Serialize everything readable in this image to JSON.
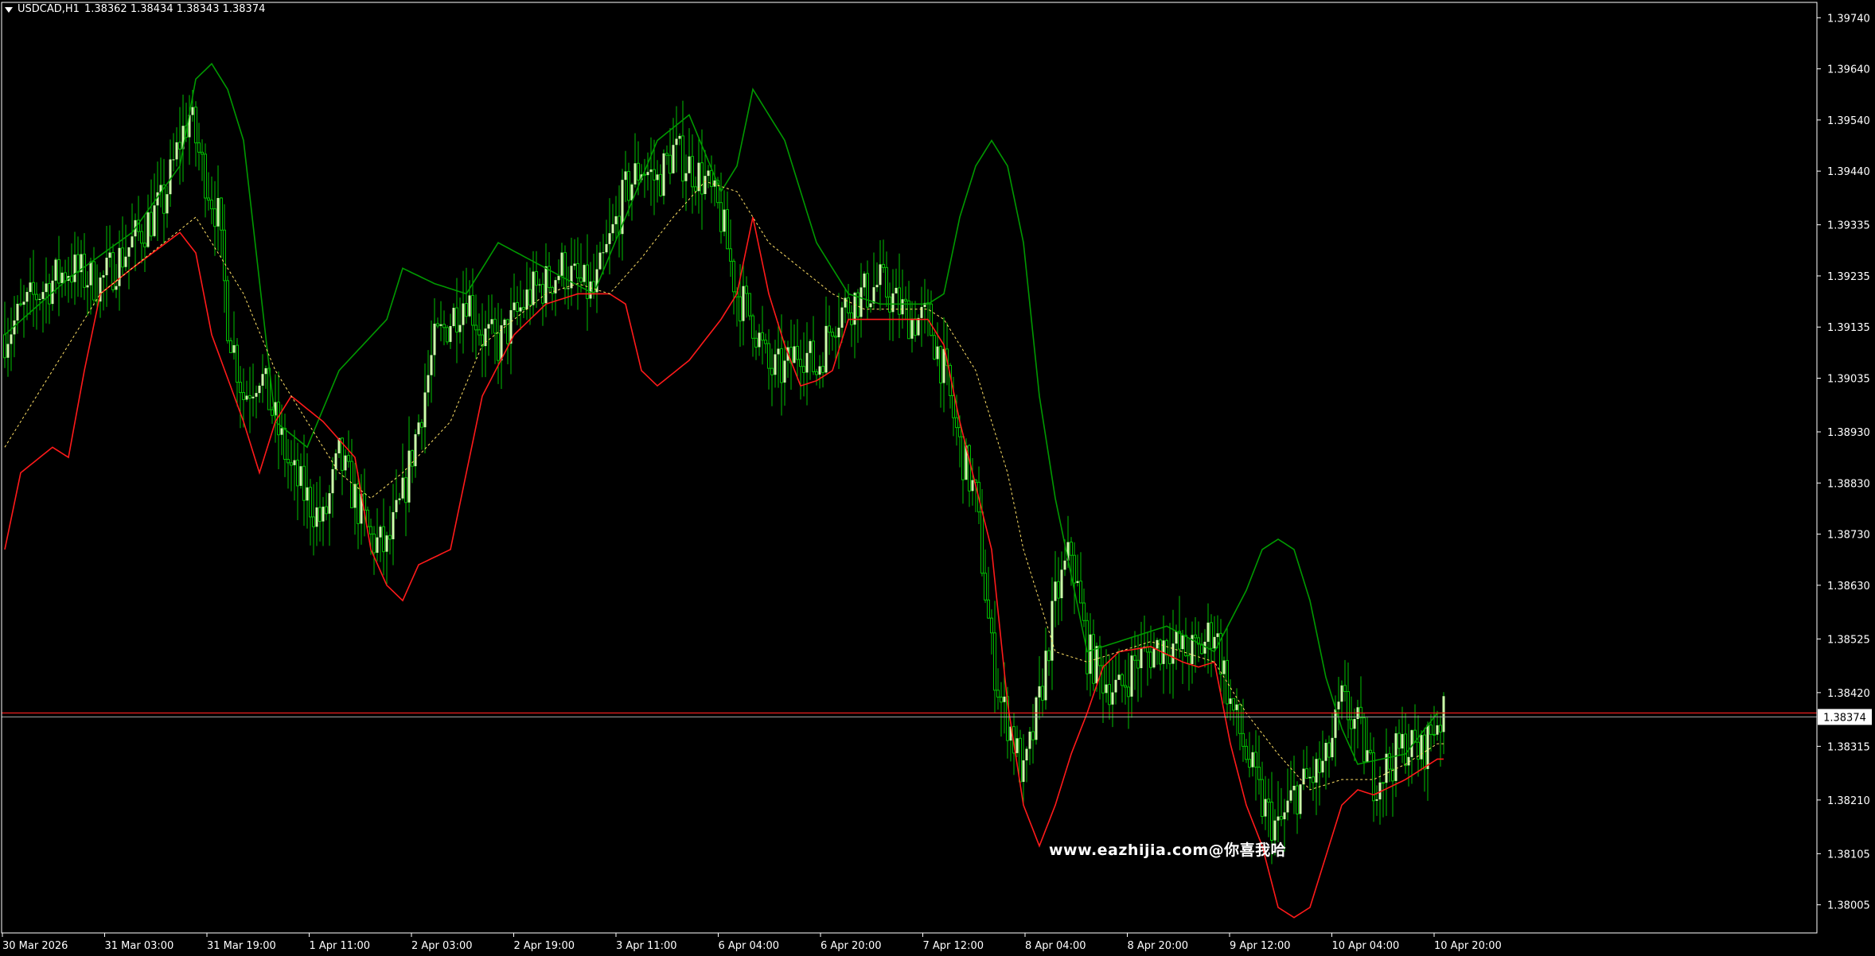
{
  "header": {
    "symbol_timeframe": "USDCAD,H1",
    "ohlc": "1.38362 1.38434 1.38343 1.38374"
  },
  "watermark": "www.eazhijia.com@你喜我哈",
  "colors": {
    "background": "#000000",
    "bull_candle": "#ccffaa",
    "wick": "#00c000",
    "upper_band": "#009900",
    "lower_band": "#ff1a1a",
    "middle_band": "#ffe066",
    "price_line": "#ff2020",
    "grid_axis": "#ffffff"
  },
  "chart_data": {
    "type": "candlestick",
    "symbol": "USDCAD",
    "timeframe": "H1",
    "ylim": [
      1.3795,
      1.3977
    ],
    "price_ticks": [
      "1.39740",
      "1.39640",
      "1.39540",
      "1.39440",
      "1.39335",
      "1.39235",
      "1.39135",
      "1.39035",
      "1.38930",
      "1.38830",
      "1.38730",
      "1.38630",
      "1.38525",
      "1.38420",
      "1.38315",
      "1.38210",
      "1.38105",
      "1.38005"
    ],
    "time_ticks": [
      "30 Mar 2026",
      "31 Mar 03:00",
      "31 Mar 19:00",
      "1 Apr 11:00",
      "2 Apr 03:00",
      "2 Apr 19:00",
      "3 Apr 11:00",
      "6 Apr 04:00",
      "6 Apr 20:00",
      "7 Apr 12:00",
      "8 Apr 04:00",
      "8 Apr 20:00",
      "9 Apr 12:00",
      "10 Apr 04:00",
      "10 Apr 20:00"
    ],
    "current_price": "1.38374",
    "close_path": [
      [
        0,
        1.3912
      ],
      [
        10,
        1.392
      ],
      [
        20,
        1.3925
      ],
      [
        30,
        1.3922
      ],
      [
        40,
        1.393
      ],
      [
        50,
        1.3938
      ],
      [
        55,
        1.395
      ],
      [
        58,
        1.3955
      ],
      [
        62,
        1.3945
      ],
      [
        67,
        1.3935
      ],
      [
        70,
        1.3915
      ],
      [
        75,
        1.39
      ],
      [
        80,
        1.3905
      ],
      [
        85,
        1.3895
      ],
      [
        90,
        1.3885
      ],
      [
        95,
        1.388
      ],
      [
        100,
        1.3875
      ],
      [
        105,
        1.3888
      ],
      [
        110,
        1.388
      ],
      [
        115,
        1.3872
      ],
      [
        120,
        1.387
      ],
      [
        125,
        1.388
      ],
      [
        130,
        1.3895
      ],
      [
        135,
        1.391
      ],
      [
        140,
        1.3915
      ],
      [
        145,
        1.392
      ],
      [
        150,
        1.3912
      ],
      [
        155,
        1.391
      ],
      [
        160,
        1.3915
      ],
      [
        165,
        1.392
      ],
      [
        170,
        1.3922
      ],
      [
        175,
        1.3925
      ],
      [
        180,
        1.3922
      ],
      [
        185,
        1.392
      ],
      [
        190,
        1.393
      ],
      [
        195,
        1.394
      ],
      [
        200,
        1.3945
      ],
      [
        205,
        1.3942
      ],
      [
        210,
        1.3948
      ],
      [
        215,
        1.3945
      ],
      [
        220,
        1.3942
      ],
      [
        225,
        1.3935
      ],
      [
        230,
        1.392
      ],
      [
        235,
        1.3915
      ],
      [
        240,
        1.3905
      ],
      [
        245,
        1.3905
      ],
      [
        250,
        1.391
      ],
      [
        255,
        1.3905
      ],
      [
        260,
        1.3915
      ],
      [
        265,
        1.3918
      ],
      [
        270,
        1.392
      ],
      [
        275,
        1.3922
      ],
      [
        280,
        1.3918
      ],
      [
        285,
        1.3915
      ],
      [
        290,
        1.3915
      ],
      [
        295,
        1.3905
      ],
      [
        300,
        1.389
      ],
      [
        305,
        1.388
      ],
      [
        310,
        1.385
      ],
      [
        313,
        1.384
      ],
      [
        316,
        1.3835
      ],
      [
        320,
        1.3825
      ],
      [
        325,
        1.384
      ],
      [
        330,
        1.386
      ],
      [
        335,
        1.387
      ],
      [
        340,
        1.385
      ],
      [
        345,
        1.3845
      ],
      [
        350,
        1.3842
      ],
      [
        355,
        1.3848
      ],
      [
        360,
        1.385
      ],
      [
        365,
        1.3852
      ],
      [
        370,
        1.385
      ],
      [
        375,
        1.385
      ],
      [
        380,
        1.3855
      ],
      [
        385,
        1.384
      ],
      [
        390,
        1.383
      ],
      [
        395,
        1.382
      ],
      [
        400,
        1.3815
      ],
      [
        405,
        1.3822
      ],
      [
        410,
        1.3825
      ],
      [
        415,
        1.3828
      ],
      [
        420,
        1.384
      ],
      [
        425,
        1.3835
      ],
      [
        430,
        1.3825
      ],
      [
        435,
        1.3828
      ],
      [
        440,
        1.3832
      ],
      [
        445,
        1.383
      ],
      [
        450,
        1.3837
      ]
    ],
    "upper_band_path": [
      [
        0,
        1.3912
      ],
      [
        20,
        1.3923
      ],
      [
        40,
        1.3932
      ],
      [
        55,
        1.3945
      ],
      [
        60,
        1.3962
      ],
      [
        65,
        1.3965
      ],
      [
        70,
        1.396
      ],
      [
        75,
        1.395
      ],
      [
        85,
        1.3895
      ],
      [
        95,
        1.389
      ],
      [
        105,
        1.3905
      ],
      [
        120,
        1.3915
      ],
      [
        125,
        1.3925
      ],
      [
        135,
        1.3922
      ],
      [
        145,
        1.392
      ],
      [
        155,
        1.393
      ],
      [
        170,
        1.3925
      ],
      [
        185,
        1.392
      ],
      [
        195,
        1.3935
      ],
      [
        205,
        1.395
      ],
      [
        215,
        1.3955
      ],
      [
        225,
        1.394
      ],
      [
        230,
        1.3945
      ],
      [
        235,
        1.396
      ],
      [
        240,
        1.3955
      ],
      [
        245,
        1.395
      ],
      [
        255,
        1.393
      ],
      [
        265,
        1.392
      ],
      [
        275,
        1.3918
      ],
      [
        290,
        1.3918
      ],
      [
        295,
        1.392
      ],
      [
        300,
        1.3935
      ],
      [
        305,
        1.3945
      ],
      [
        310,
        1.395
      ],
      [
        315,
        1.3945
      ],
      [
        320,
        1.393
      ],
      [
        325,
        1.39
      ],
      [
        330,
        1.388
      ],
      [
        335,
        1.3865
      ],
      [
        340,
        1.385
      ],
      [
        350,
        1.3852
      ],
      [
        365,
        1.3855
      ],
      [
        380,
        1.385
      ],
      [
        390,
        1.3862
      ],
      [
        395,
        1.387
      ],
      [
        400,
        1.3872
      ],
      [
        405,
        1.387
      ],
      [
        410,
        1.386
      ],
      [
        415,
        1.3845
      ],
      [
        420,
        1.3835
      ],
      [
        425,
        1.3828
      ],
      [
        440,
        1.383
      ],
      [
        450,
        1.3838
      ]
    ],
    "lower_band_path": [
      [
        0,
        1.387
      ],
      [
        5,
        1.3885
      ],
      [
        15,
        1.389
      ],
      [
        20,
        1.3888
      ],
      [
        25,
        1.3905
      ],
      [
        30,
        1.392
      ],
      [
        40,
        1.3925
      ],
      [
        55,
        1.3932
      ],
      [
        60,
        1.3928
      ],
      [
        65,
        1.3912
      ],
      [
        75,
        1.3895
      ],
      [
        80,
        1.3885
      ],
      [
        85,
        1.3895
      ],
      [
        90,
        1.39
      ],
      [
        100,
        1.3895
      ],
      [
        110,
        1.3888
      ],
      [
        115,
        1.387
      ],
      [
        120,
        1.3863
      ],
      [
        125,
        1.386
      ],
      [
        130,
        1.3867
      ],
      [
        140,
        1.387
      ],
      [
        145,
        1.3885
      ],
      [
        150,
        1.39
      ],
      [
        160,
        1.3912
      ],
      [
        170,
        1.3918
      ],
      [
        180,
        1.392
      ],
      [
        190,
        1.392
      ],
      [
        195,
        1.3918
      ],
      [
        200,
        1.3905
      ],
      [
        205,
        1.3902
      ],
      [
        215,
        1.3907
      ],
      [
        225,
        1.3915
      ],
      [
        230,
        1.392
      ],
      [
        235,
        1.3935
      ],
      [
        240,
        1.392
      ],
      [
        245,
        1.391
      ],
      [
        250,
        1.3902
      ],
      [
        255,
        1.3903
      ],
      [
        260,
        1.3905
      ],
      [
        265,
        1.3915
      ],
      [
        275,
        1.3915
      ],
      [
        290,
        1.3915
      ],
      [
        295,
        1.391
      ],
      [
        300,
        1.3895
      ],
      [
        310,
        1.387
      ],
      [
        315,
        1.384
      ],
      [
        320,
        1.382
      ],
      [
        325,
        1.3812
      ],
      [
        330,
        1.382
      ],
      [
        335,
        1.383
      ],
      [
        340,
        1.3838
      ],
      [
        345,
        1.3847
      ],
      [
        350,
        1.385
      ],
      [
        360,
        1.3851
      ],
      [
        370,
        1.3848
      ],
      [
        375,
        1.3847
      ],
      [
        380,
        1.3848
      ],
      [
        385,
        1.3832
      ],
      [
        390,
        1.382
      ],
      [
        395,
        1.3812
      ],
      [
        400,
        1.38
      ],
      [
        405,
        1.3798
      ],
      [
        410,
        1.38
      ],
      [
        415,
        1.381
      ],
      [
        420,
        1.382
      ],
      [
        425,
        1.3823
      ],
      [
        430,
        1.3822
      ],
      [
        440,
        1.3825
      ],
      [
        450,
        1.3829
      ]
    ],
    "middle_band_path": [
      [
        0,
        1.389
      ],
      [
        15,
        1.3905
      ],
      [
        30,
        1.392
      ],
      [
        50,
        1.393
      ],
      [
        60,
        1.3935
      ],
      [
        65,
        1.393
      ],
      [
        75,
        1.392
      ],
      [
        85,
        1.3905
      ],
      [
        95,
        1.3895
      ],
      [
        105,
        1.3885
      ],
      [
        115,
        1.388
      ],
      [
        125,
        1.3885
      ],
      [
        140,
        1.3895
      ],
      [
        150,
        1.391
      ],
      [
        160,
        1.3915
      ],
      [
        170,
        1.392
      ],
      [
        180,
        1.3922
      ],
      [
        190,
        1.392
      ],
      [
        200,
        1.3927
      ],
      [
        210,
        1.3935
      ],
      [
        220,
        1.3942
      ],
      [
        230,
        1.394
      ],
      [
        240,
        1.393
      ],
      [
        250,
        1.3925
      ],
      [
        260,
        1.392
      ],
      [
        270,
        1.3917
      ],
      [
        280,
        1.3917
      ],
      [
        290,
        1.3917
      ],
      [
        295,
        1.3915
      ],
      [
        305,
        1.3905
      ],
      [
        315,
        1.3885
      ],
      [
        320,
        1.387
      ],
      [
        325,
        1.386
      ],
      [
        330,
        1.385
      ],
      [
        340,
        1.3848
      ],
      [
        350,
        1.385
      ],
      [
        360,
        1.3852
      ],
      [
        370,
        1.385
      ],
      [
        380,
        1.3848
      ],
      [
        390,
        1.3838
      ],
      [
        400,
        1.383
      ],
      [
        410,
        1.3823
      ],
      [
        420,
        1.3825
      ],
      [
        430,
        1.3825
      ],
      [
        440,
        1.3828
      ],
      [
        450,
        1.3832
      ]
    ]
  }
}
